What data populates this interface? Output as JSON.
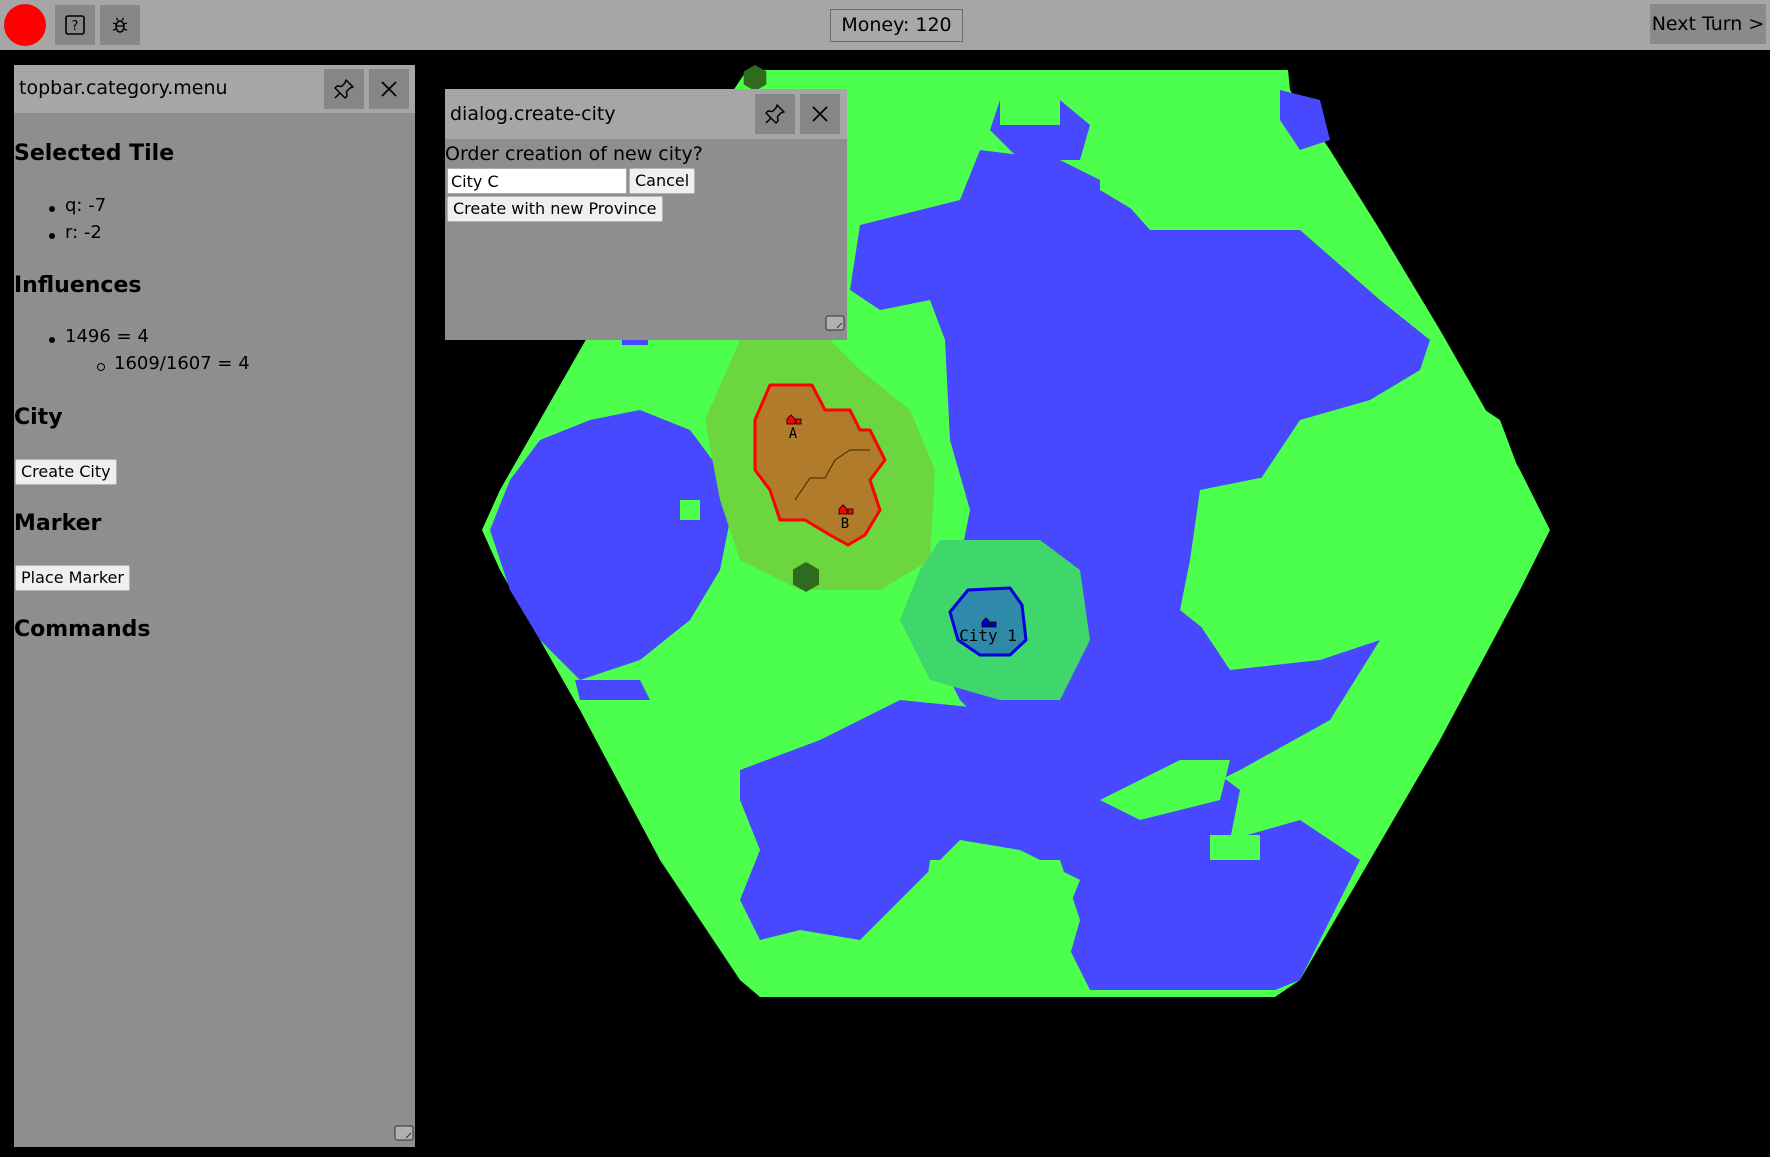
{
  "topbar": {
    "money": "Money: 120",
    "next_turn": "Next Turn >",
    "help_icon": "question-box-icon",
    "debug_icon": "bug-icon",
    "status_color": "#ff0000"
  },
  "left_panel": {
    "title": "topbar.category.menu",
    "selected_tile": {
      "heading": "Selected Tile",
      "q": "q: -7",
      "r": "r: -2"
    },
    "influences": {
      "heading": "Influences",
      "item": "1496 = 4",
      "subitem": "1609/1607 = 4"
    },
    "city": {
      "heading": "City",
      "create_button": "Create City"
    },
    "marker": {
      "heading": "Marker",
      "place_button": "Place Marker"
    },
    "commands": {
      "heading": "Commands"
    }
  },
  "dialog": {
    "title": "dialog.create-city",
    "prompt": "Order creation of new city?",
    "name_value": "City C",
    "cancel": "Cancel",
    "create_province": "Create with new Province"
  },
  "map": {
    "cities": [
      {
        "label": "A",
        "owner_color": "#ff0000"
      },
      {
        "label": "B",
        "owner_color": "#ff0000"
      },
      {
        "label": "City 1",
        "owner_color": "#0000cc"
      }
    ],
    "colors": {
      "land": "#4cff4c",
      "water": "#4848ff",
      "red_influence": "#6bd63f",
      "red_territory": "#b07b2a",
      "red_border": "#ff0000",
      "blue_influence": "#3fd66b",
      "blue_territory": "#2f8aaa",
      "blue_border": "#0000e0",
      "marker_tile": "#2e6b1e"
    }
  }
}
